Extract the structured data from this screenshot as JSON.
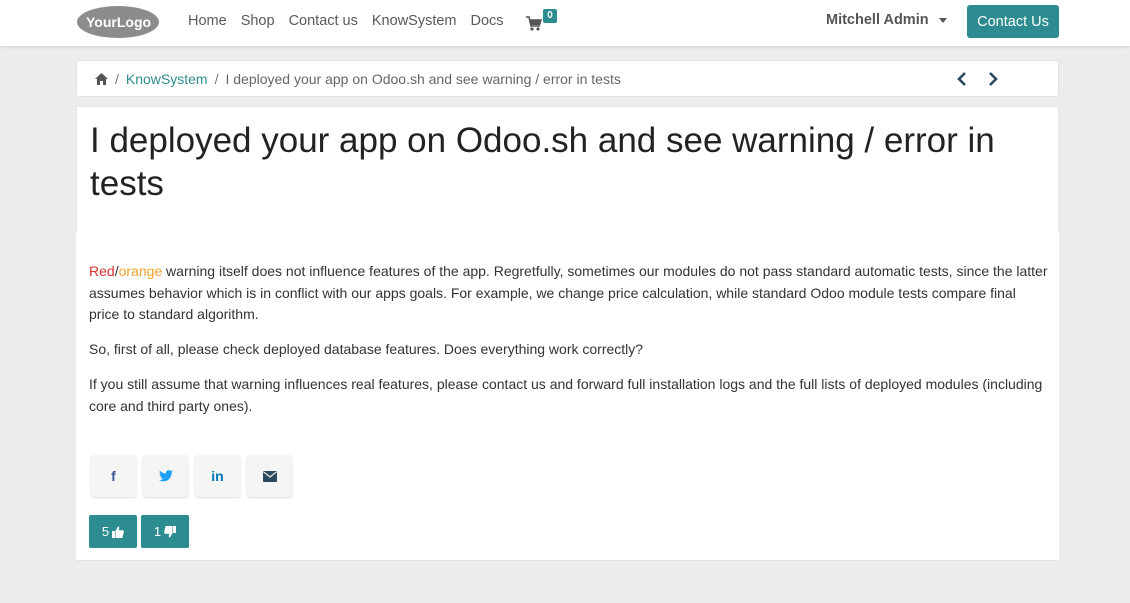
{
  "header": {
    "logo_text": "YourLogo",
    "nav": [
      "Home",
      "Shop",
      "Contact us",
      "KnowSystem",
      "Docs"
    ],
    "cart_count": "0",
    "user_name": "Mitchell Admin",
    "contact_button": "Contact Us"
  },
  "breadcrumb": {
    "sep1": "/",
    "section": "KnowSystem",
    "sep2": "/",
    "current": "I deployed your app on Odoo.sh and see warning / error in tests"
  },
  "article": {
    "title": "I deployed your app on Odoo.sh and see warning / error in tests",
    "p1_red": "Red",
    "p1_slash": "/",
    "p1_orange": "orange",
    "p1_rest": " warning itself does not influence features of the app. Regretfully, sometimes our modules do not pass standard automatic tests, since the latter assumes behavior which is in conflict with our apps goals. For example, we change price calculation, while standard Odoo module tests compare final price to standard algorithm.",
    "p2": "So, first of all, please check deployed database features. Does everything work correctly?",
    "p3": "If you still assume that warning influences real features, please contact us and forward full installation logs and the full lists of deployed modules (including core and third party ones)."
  },
  "share": {
    "facebook": "f",
    "linkedin": "in"
  },
  "votes": {
    "likes": "5",
    "dislikes": "1"
  },
  "colors": {
    "accent": "#2c8c8f",
    "red": "#d9302c",
    "orange": "#f5a02c",
    "facebook": "#3b5998",
    "twitter": "#1da1f2",
    "linkedin": "#0077b5",
    "email": "#2c4a5e"
  }
}
